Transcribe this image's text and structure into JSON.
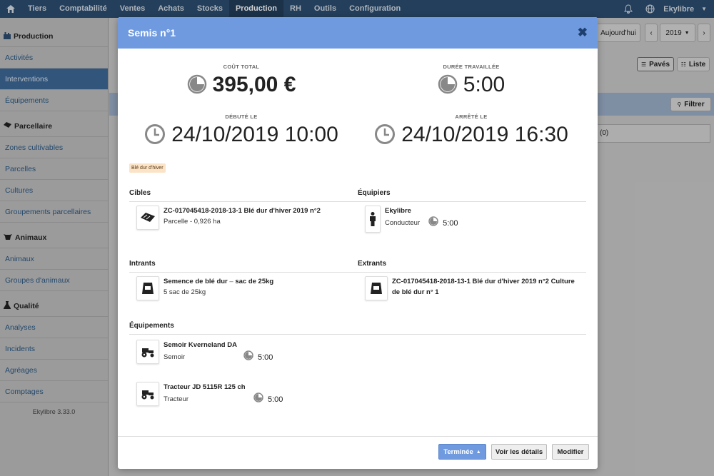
{
  "topnav": {
    "items": [
      "Tiers",
      "Comptabilité",
      "Ventes",
      "Achats",
      "Stocks",
      "Production",
      "RH",
      "Outils",
      "Configuration"
    ],
    "user": "Ekylibre"
  },
  "sidebar": {
    "production": {
      "label": "Production",
      "items": [
        "Activités",
        "Interventions",
        "Équipements"
      ]
    },
    "parcellaire": {
      "label": "Parcellaire",
      "items": [
        "Zones cultivables",
        "Parcelles",
        "Cultures",
        "Groupements parcellaires"
      ]
    },
    "animaux": {
      "label": "Animaux",
      "items": [
        "Animaux",
        "Groupes d'animaux"
      ]
    },
    "qualite": {
      "label": "Qualité",
      "items": [
        "Analyses",
        "Incidents",
        "Agréages",
        "Comptages"
      ]
    },
    "version": "Ekylibre 3.33.0"
  },
  "background": {
    "today": "Aujourd'hui",
    "year": "2019",
    "view_tiles": "Pavés",
    "view_list": "Liste",
    "filter": "Filtrer",
    "count": "(0)"
  },
  "modal": {
    "title": "Semis n°1",
    "cost_label": "Coût total",
    "cost_value": "395,00 €",
    "duration_label": "Durée travaillée",
    "duration_value": "5:00",
    "started_label": "Débuté le",
    "started_value": "24/10/2019 10:00",
    "stopped_label": "Arrêté le",
    "stopped_value": "24/10/2019 16:30",
    "tag": "Blé dur d'hiver",
    "targets": {
      "title": "Cibles",
      "name": "ZC-017045418-2018-13-1 Blé dur d'hiver 2019 n°2",
      "detail": "Parcelle - 0,926 ha"
    },
    "doers": {
      "title": "Équipiers",
      "name": "Ekylibre",
      "role": "Conducteur",
      "duration": "5:00"
    },
    "inputs": {
      "title": "Intrants",
      "name": "Semence de blé dur",
      "name_suffix": "sac de 25kg",
      "quantity": "5 sac de 25kg"
    },
    "outputs": {
      "title": "Extrants",
      "name_line1": "ZC-017045418-2018-13-1 Blé dur d'hiver 2019 n°2 Culture",
      "name_line2": "de blé dur n° 1"
    },
    "equipments": {
      "title": "Équipements",
      "items": [
        {
          "name": "Semoir Kverneland DA",
          "type": "Semoir",
          "duration": "5:00"
        },
        {
          "name": "Tracteur JD 5115R 125 ch",
          "type": "Tracteur",
          "duration": "5:00"
        }
      ]
    },
    "footer": {
      "status": "Terminée",
      "details": "Voir les détails",
      "edit": "Modifier"
    }
  }
}
